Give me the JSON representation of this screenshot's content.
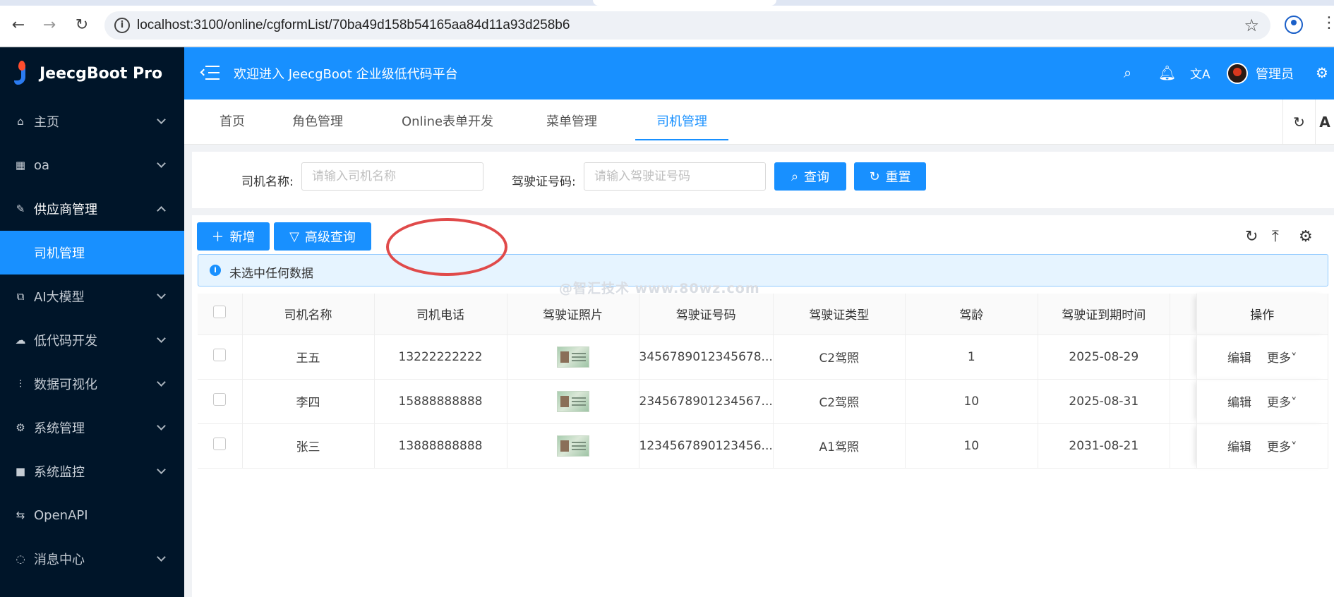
{
  "browser": {
    "url": "localhost:3100/online/cgformList/70ba49d158b54165aa84d11a93d258b6"
  },
  "sidebar": {
    "brand": "JeecgBoot Pro",
    "items": [
      {
        "label": "主页",
        "icon": "home-icon"
      },
      {
        "label": "oa",
        "icon": "grid-icon"
      },
      {
        "label": "供应商管理",
        "icon": "edit-icon"
      },
      {
        "label": "司机管理",
        "icon": ""
      },
      {
        "label": "AI大模型",
        "icon": "ai-icon"
      },
      {
        "label": "低代码开发",
        "icon": "cloud-icon"
      },
      {
        "label": "数据可视化",
        "icon": "chart-icon"
      },
      {
        "label": "系统管理",
        "icon": "gear-icon"
      },
      {
        "label": "系统监控",
        "icon": "video-icon"
      },
      {
        "label": "OpenAPI",
        "icon": "swap-icon"
      },
      {
        "label": "消息中心",
        "icon": "message-icon"
      }
    ]
  },
  "header": {
    "welcome": "欢迎进入 JeecgBoot 企业级低代码平台",
    "user": "管理员"
  },
  "tabs": [
    {
      "label": "首页"
    },
    {
      "label": "角色管理"
    },
    {
      "label": "Online表单开发"
    },
    {
      "label": "菜单管理"
    },
    {
      "label": "司机管理"
    }
  ],
  "search": {
    "name_label": "司机名称:",
    "name_placeholder": "请输入司机名称",
    "license_label": "驾驶证号码:",
    "license_placeholder": "请输入驾驶证号码",
    "query": "查询",
    "reset": "重置"
  },
  "toolbar": {
    "add": "新增",
    "advanced": "高级查询"
  },
  "alert": "未选中任何数据",
  "watermark": "@智汇技术 www.80wz.com",
  "table": {
    "columns": [
      "司机名称",
      "司机电话",
      "驾驶证照片",
      "驾驶证号码",
      "驾驶证类型",
      "驾龄",
      "驾驶证到期时间",
      "",
      "操作"
    ],
    "rows": [
      {
        "name": "王五",
        "phone": "13222222222",
        "license_no": "3456789012345678...",
        "type": "C2驾照",
        "years": "1",
        "expire": "2025-08-29"
      },
      {
        "name": "李四",
        "phone": "15888888888",
        "license_no": "2345678901234567...",
        "type": "C2驾照",
        "years": "10",
        "expire": "2025-08-31"
      },
      {
        "name": "张三",
        "phone": "13888888888",
        "license_no": "1234567890123456...",
        "type": "A1驾照",
        "years": "10",
        "expire": "2031-08-21"
      }
    ],
    "edit": "编辑",
    "more": "更多"
  },
  "colors": {
    "primary": "#1890ff",
    "sidebar_bg": "#001529",
    "annotation_circle": "#e04a4a"
  }
}
